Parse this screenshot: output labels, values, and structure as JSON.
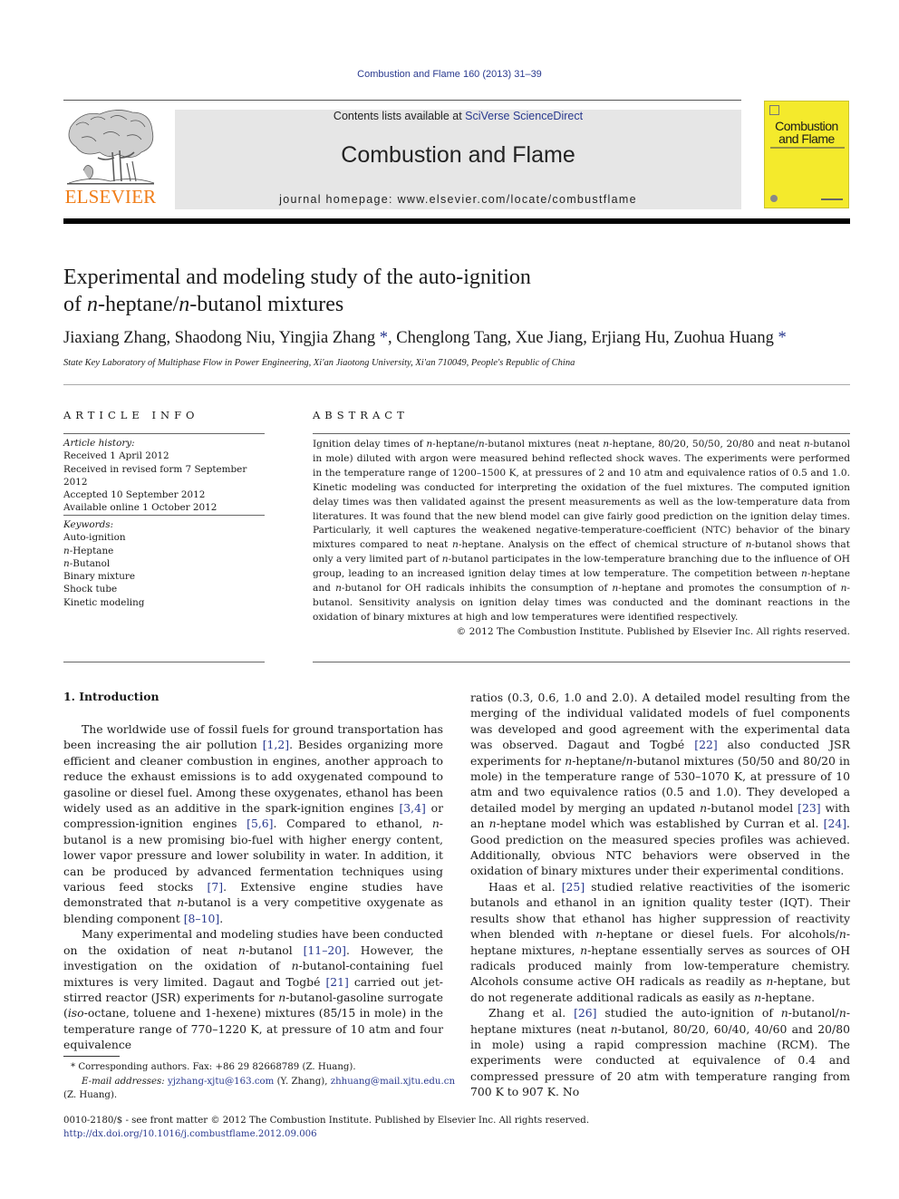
{
  "header": {
    "citation": "Combustion and Flame 160 (2013) 31–39",
    "publisher_logo_text": "ELSEVIER",
    "contents_prefix": "Contents lists available at ",
    "contents_link": "SciVerse ScienceDirect",
    "journal_name": "Combustion and Flame",
    "homepage_prefix": "journal homepage: ",
    "homepage_url": "www.elsevier.com/locate/combustflame",
    "cover_title_line1": "Combustion",
    "cover_title_line2": "and Flame"
  },
  "article": {
    "title_line1": "Experimental and modeling study of the auto-ignition",
    "title_line2_pre": "of ",
    "title_line2_n1": "n",
    "title_line2_mid": "-heptane/",
    "title_line2_n2": "n",
    "title_line2_post": "-butanol mixtures",
    "authors": [
      {
        "name": "Jiaxiang Zhang",
        "corresponding": false
      },
      {
        "name": "Shaodong Niu",
        "corresponding": false
      },
      {
        "name": "Yingjia Zhang",
        "corresponding": true
      },
      {
        "name": "Chenglong Tang",
        "corresponding": false
      },
      {
        "name": "Xue Jiang",
        "corresponding": false
      },
      {
        "name": "Erjiang Hu",
        "corresponding": false
      },
      {
        "name": "Zuohua Huang",
        "corresponding": true
      }
    ],
    "author_separator": ", ",
    "corresponding_mark": "*",
    "affiliation": "State Key Laboratory of Multiphase Flow in Power Engineering, Xi'an Jiaotong University, Xi'an 710049, People's Republic of China"
  },
  "article_info": {
    "heading": "ARTICLE INFO",
    "history_label": "Article history:",
    "history": [
      "Received 1 April 2012",
      "Received in revised form 7 September 2012",
      "Accepted 10 September 2012",
      "Available online 1 October 2012"
    ],
    "keywords_label": "Keywords:",
    "keywords": [
      {
        "prefix": "",
        "text": "Auto-ignition"
      },
      {
        "prefix": "n",
        "text": "-Heptane"
      },
      {
        "prefix": "n",
        "text": "-Butanol"
      },
      {
        "prefix": "",
        "text": "Binary mixture"
      },
      {
        "prefix": "",
        "text": "Shock tube"
      },
      {
        "prefix": "",
        "text": "Kinetic modeling"
      }
    ]
  },
  "abstract": {
    "heading": "ABSTRACT",
    "html": "Ignition delay times of <i>n</i>-heptane/<i>n</i>-butanol mixtures (neat <i>n</i>-heptane, 80/20, 50/50, 20/80 and neat <i>n</i>-butanol in mole) diluted with argon were measured behind reflected shock waves. The experiments were performed in the temperature range of 1200–1500 K, at pressures of 2 and 10 atm and equivalence ratios of 0.5 and 1.0. Kinetic modeling was conducted for interpreting the oxidation of the fuel mixtures. The computed ignition delay times was then validated against the present measurements as well as the low-temperature data from literatures. It was found that the new blend model can give fairly good prediction on the ignition delay times. Particularly, it well captures the weakened negative-temperature-coefficient (NTC) behavior of the binary mixtures compared to neat <i>n</i>-heptane. Analysis on the effect of chemical structure of <i>n</i>-butanol shows that only a very limited part of <i>n</i>-butanol participates in the low-temperature branching due to the influence of OH group, leading to an increased ignition delay times at low temperature. The competition between <i>n</i>-heptane and <i>n</i>-butanol for OH radicals inhibits the consumption of <i>n</i>-heptane and promotes the consumption of <i>n</i>-butanol. Sensitivity analysis on ignition delay times was conducted and the dominant reactions in the oxidation of binary mixtures at high and low temperatures were identified respectively.",
    "copyright": "© 2012 The Combustion Institute. Published by Elsevier Inc. All rights reserved."
  },
  "introduction": {
    "heading": "1. Introduction",
    "left_paragraphs": [
      "The worldwide use of fossil fuels for ground transportation has been increasing the air pollution <span class=\"ref\">[1,2]</span>. Besides organizing more efficient and cleaner combustion in engines, another approach to reduce the exhaust emissions is to add oxygenated compound to gasoline or diesel fuel. Among these oxygenates, ethanol has been widely used as an additive in the spark-ignition engines <span class=\"ref\">[3,4]</span> or compression-ignition engines <span class=\"ref\">[5,6]</span>. Compared to ethanol, <i>n</i>-butanol is a new promising bio-fuel with higher energy content, lower vapor pressure and lower solubility in water. In addition, it can be produced by advanced fermentation techniques using various feed stocks <span class=\"ref\">[7]</span>. Extensive engine studies have demonstrated that <i>n</i>-butanol is a very competitive oxygenate as blending component <span class=\"ref\">[8–10]</span>.",
      "Many experimental and modeling studies have been conducted on the oxidation of neat <i>n</i>-butanol <span class=\"ref\">[11–20]</span>. However, the investigation on the oxidation of <i>n</i>-butanol-containing fuel mixtures is very limited. Dagaut and Togbé <span class=\"ref\">[21]</span> carried out jet-stirred reactor (JSR) experiments for <i>n</i>-butanol-gasoline surrogate (<i>iso</i>-octane, toluene and 1-hexene) mixtures (85/15 in mole) in the temperature range of 770–1220 K, at pressure of 10 atm and four equivalence"
    ],
    "right_paragraphs": [
      "ratios (0.3, 0.6, 1.0 and 2.0). A detailed model resulting from the merging of the individual validated models of fuel components was developed and good agreement with the experimental data was observed. Dagaut and Togbé <span class=\"ref\">[22]</span> also conducted JSR experiments for <i>n</i>-heptane/<i>n</i>-butanol mixtures (50/50 and 80/20 in mole) in the temperature range of 530–1070 K, at pressure of 10 atm and two equivalence ratios (0.5 and 1.0). They developed a detailed model by merging an updated <i>n</i>-butanol model <span class=\"ref\">[23]</span> with an <i>n</i>-heptane model which was established by Curran et al. <span class=\"ref\">[24]</span>. Good prediction on the measured species profiles was achieved. Additionally, obvious NTC behaviors were observed in the oxidation of binary mixtures under their experimental conditions.",
      "Haas et al. <span class=\"ref\">[25]</span> studied relative reactivities of the isomeric butanols and ethanol in an ignition quality tester (IQT). Their results show that ethanol has higher suppression of reactivity when blended with <i>n</i>-heptane or diesel fuels. For alcohols/<i>n</i>-heptane mixtures, <i>n</i>-heptane essentially serves as sources of OH radicals produced mainly from low-temperature chemistry. Alcohols consume active OH radicals as readily as <i>n</i>-heptane, but do not regenerate additional radicals as easily as <i>n</i>-heptane.",
      "Zhang et al. <span class=\"ref\">[26]</span> studied the auto-ignition of <i>n</i>-butanol/<i>n</i>-heptane mixtures (neat <i>n</i>-butanol, 80/20, 60/40, 40/60 and 20/80 in mole) using a rapid compression machine (RCM). The experiments were conducted at equivalence of 0.4 and compressed pressure of 20 atm with temperature ranging from 700 K to 907 K. No"
    ]
  },
  "footnote": {
    "mark": "*",
    "corresponding_text": "Corresponding authors. Fax: +86 29 82668789 (Z. Huang).",
    "email_label": "E-mail addresses:",
    "email1": "yjzhang-xjtu@163.com",
    "email1_owner": " (Y. Zhang), ",
    "email2": "zhhuang@mail.xjtu.edu.cn",
    "email2_owner": "(Z. Huang)."
  },
  "bottom_meta": {
    "issn_line": "0010-2180/$ - see front matter © 2012 The Combustion Institute. Published by Elsevier Inc. All rights reserved.",
    "doi": "http://dx.doi.org/10.1016/j.combustflame.2012.09.006"
  },
  "colors": {
    "link": "#2a3a8f",
    "elsevier_orange": "#f07d18",
    "masthead_bg": "#e6e6e6",
    "cover_yellow": "#f4ea2c"
  }
}
